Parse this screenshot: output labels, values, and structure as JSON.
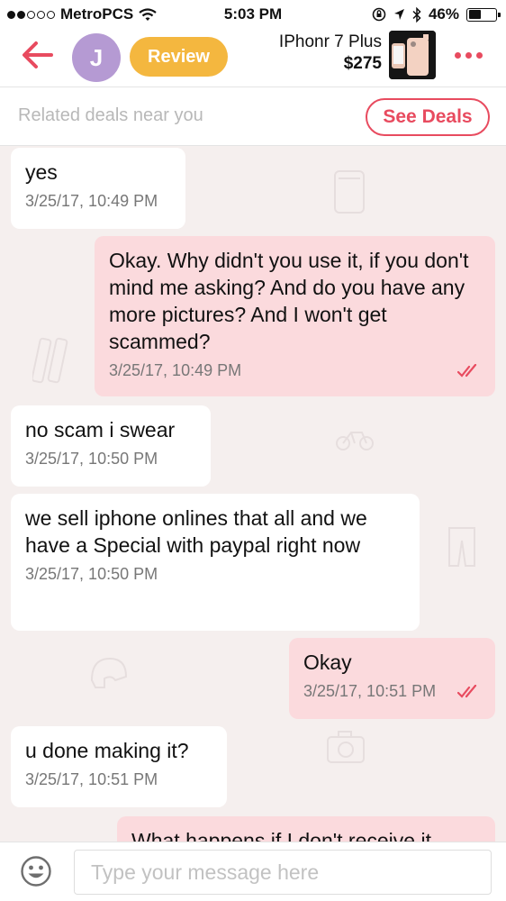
{
  "status_bar": {
    "carrier": "MetroPCS",
    "time": "5:03 PM",
    "battery": "46%",
    "battery_level": 0.46
  },
  "header": {
    "avatar_initial": "J",
    "review_label": "Review",
    "product_title": "IPhonr 7 Plus",
    "product_price": "$275"
  },
  "deals": {
    "text": "Related deals near you",
    "button_label": "See Deals"
  },
  "messages": [
    {
      "direction": "in",
      "text": "yes",
      "time": "3/25/17, 10:49 PM"
    },
    {
      "direction": "out",
      "text": "Okay. Why didn't you use it, if you don't mind me asking? And do you have any more pictures? And I won't get scammed?",
      "time": "3/25/17, 10:49 PM"
    },
    {
      "direction": "in",
      "text": "no scam i swear",
      "time": "3/25/17, 10:50 PM"
    },
    {
      "direction": "in",
      "text": "we sell iphone onlines that all and we have a Special with paypal right now",
      "time": "3/25/17, 10:50 PM"
    },
    {
      "direction": "out",
      "text": "Okay",
      "time": "3/25/17, 10:51 PM"
    },
    {
      "direction": "in",
      "text": "u done making it?",
      "time": "3/25/17, 10:51 PM"
    },
    {
      "direction": "out",
      "text": "What happens if I don't receive it",
      "time": ""
    }
  ],
  "input": {
    "placeholder": "Type your message here"
  },
  "colors": {
    "accent": "#e84b5f",
    "review": "#f4b73f",
    "avatar": "#b59ad3",
    "outgoing_bubble": "#fbdadd",
    "incoming_bubble": "#ffffff"
  }
}
